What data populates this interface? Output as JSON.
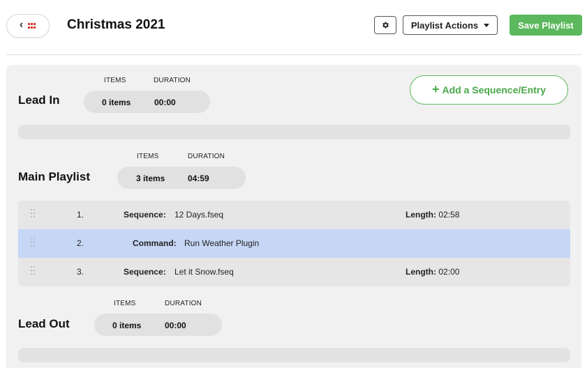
{
  "header": {
    "title": "Christmas 2021",
    "back_icon": "chevron-left-icon",
    "grid_icon": "grid-icon",
    "settings_icon": "gear-icon",
    "actions_label": "Playlist Actions",
    "save_label": "Save Playlist",
    "colors": {
      "save": "#5cb85c",
      "grid_icon": "#d9342b"
    }
  },
  "add_entry_label": "Add a Sequence/Entry",
  "stat_labels": {
    "items": "ITEMS",
    "duration": "DURATION"
  },
  "sections": {
    "lead_in": {
      "title": "Lead In",
      "items": "0 items",
      "duration": "00:00"
    },
    "main": {
      "title": "Main Playlist",
      "items": "3 items",
      "duration": "04:59"
    },
    "lead_out": {
      "title": "Lead Out",
      "items": "0 items",
      "duration": "00:00"
    }
  },
  "entries": [
    {
      "num": "1.",
      "type": "Sequence:",
      "name": "12 Days.fseq",
      "length_label": "Length:",
      "length": "02:58"
    },
    {
      "num": "2.",
      "type": "Command:",
      "name": "Run Weather Plugin",
      "length_label": "",
      "length": ""
    },
    {
      "num": "3.",
      "type": "Sequence:",
      "name": "Let it Snow.fseq",
      "length_label": "Length:",
      "length": "02:00"
    }
  ],
  "selected_entry": 2,
  "colors": {
    "selected_row": "#c6d6f5",
    "panel": "#f1f1f1"
  }
}
